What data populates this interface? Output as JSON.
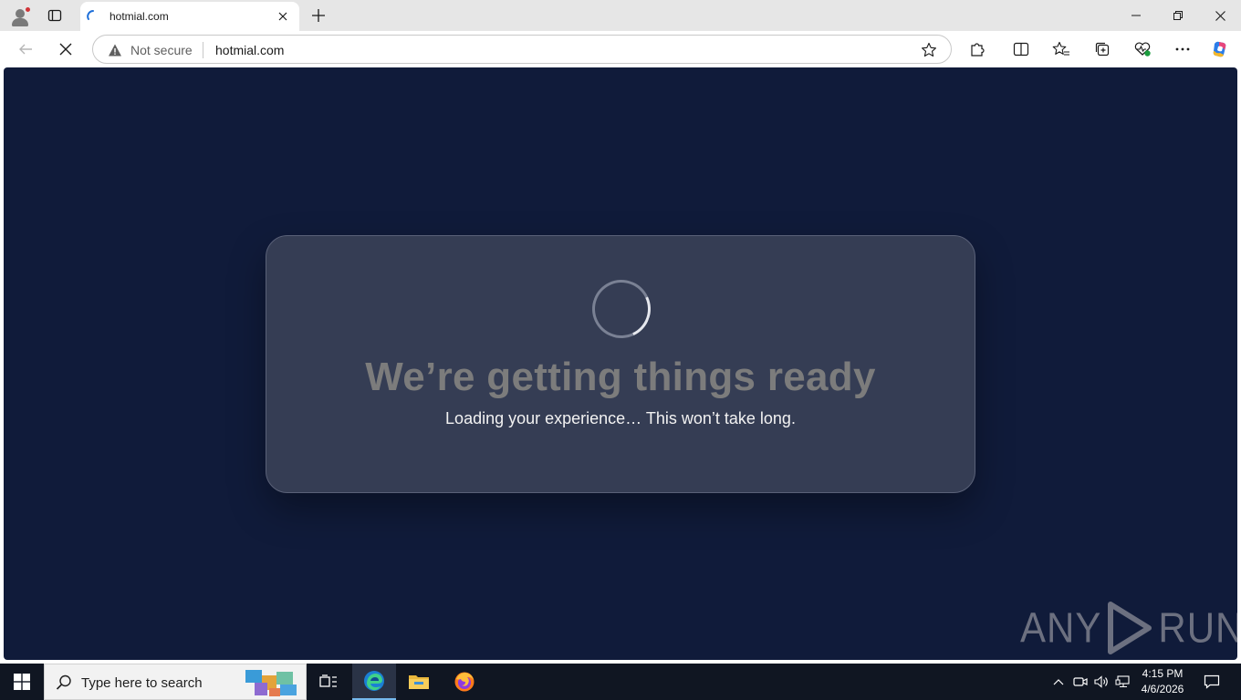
{
  "browser": {
    "tab": {
      "title": "hotmial.com"
    },
    "address": {
      "security_label": "Not secure",
      "url": "hotmial.com"
    }
  },
  "page": {
    "heading": "We’re getting things ready",
    "subtext": "Loading your experience… This won’t take long.",
    "watermark_left": "ANY",
    "watermark_right": "RUN"
  },
  "taskbar": {
    "search_placeholder": "Type here to search",
    "time": "4:15 PM",
    "date": "4/6/2026"
  },
  "icons": {
    "profile": "profile-icon",
    "tab_actions": "tab-actions-icon",
    "favicon": "loading-favicon",
    "warning": "warning-icon",
    "star": "star-icon",
    "extensions": "puzzle-icon",
    "split": "split-screen-icon",
    "favorites": "favorites-icon",
    "collections": "collections-icon",
    "performance": "heart-pulse-icon",
    "more": "ellipsis-icon",
    "copilot": "copilot-icon"
  },
  "colors": {
    "page_background": "#101b3a",
    "card_background": "#353d54",
    "heading": "#7c7c7c",
    "subtext": "#f2f2f2",
    "taskbar": "#101622"
  }
}
